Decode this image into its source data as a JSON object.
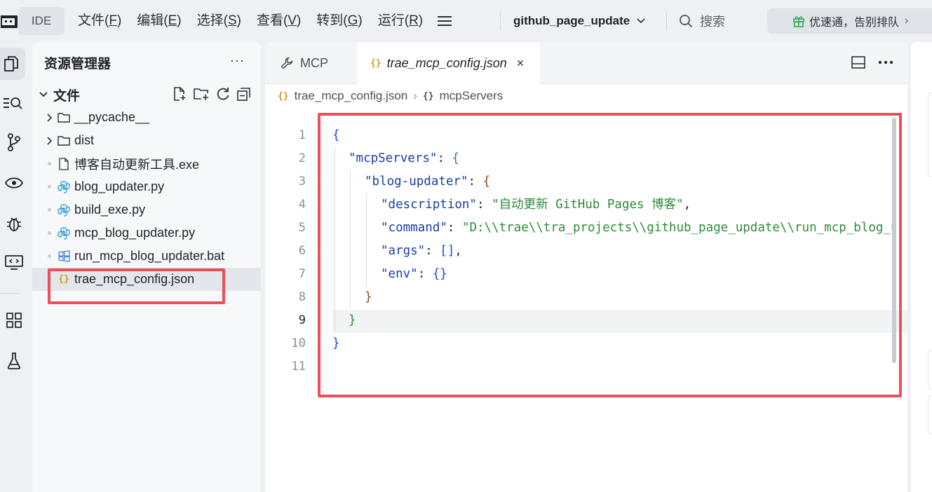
{
  "topbar": {
    "ide_label": "IDE",
    "menu": [
      {
        "text": "文件(",
        "key": "F",
        "end": ")"
      },
      {
        "text": "编辑(",
        "key": "E",
        "end": ")"
      },
      {
        "text": "选择(",
        "key": "S",
        "end": ")"
      },
      {
        "text": "查看(",
        "key": "V",
        "end": ")"
      },
      {
        "text": "转到(",
        "key": "G",
        "end": ")"
      },
      {
        "text": "运行(",
        "key": "R",
        "end": ")"
      }
    ],
    "project_name": "github_page_update",
    "search_label": "搜索",
    "promo_label": "优速通，告别排队",
    "promo_arrow": "›"
  },
  "explorer": {
    "title": "资源管理器",
    "more": "···",
    "folder_name": "文件",
    "items": [
      {
        "label": "__pycache__",
        "type": "folder"
      },
      {
        "label": "dist",
        "type": "folder"
      },
      {
        "label": "博客自动更新工具.exe",
        "type": "file"
      },
      {
        "label": "blog_updater.py",
        "type": "python"
      },
      {
        "label": "build_exe.py",
        "type": "python"
      },
      {
        "label": "mcp_blog_updater.py",
        "type": "python"
      },
      {
        "label": "run_mcp_blog_updater.bat",
        "type": "windows"
      },
      {
        "label": "trae_mcp_config.json",
        "type": "json"
      }
    ],
    "selected": "trae_mcp_config.json"
  },
  "editor": {
    "tabs": [
      {
        "label": "MCP",
        "icon": "wrench-icon"
      },
      {
        "label": "trae_mcp_config.json",
        "icon": "json-icon",
        "close": "×"
      }
    ],
    "breadcrumb": [
      "trae_mcp_config.json",
      "mcpServers"
    ],
    "json_icon_glyph": "{}",
    "breadcrumb_sep": "›",
    "line_numbers": [
      "1",
      "2",
      "3",
      "4",
      "5",
      "6",
      "7",
      "8",
      "9",
      "10",
      "11"
    ],
    "current_line": "9",
    "code": {
      "l1_open": "{",
      "l2_key": "\"mcpServers\"",
      "l2_colon": ": ",
      "l2_open": "{",
      "l3_key": "\"blog-updater\"",
      "l3_colon": ": ",
      "l3_open": "{",
      "l4_key": "\"description\"",
      "l4_colon": ": ",
      "l4_val": "\"自动更新 GitHub Pages 博客\"",
      "l4_comma": ",",
      "l5_key": "\"command\"",
      "l5_colon": ": ",
      "l5_val": "\"D:\\\\trae\\\\tra_projects\\\\github_page_update\\\\run_mcp_blog_updater.bat\"",
      "l6_key": "\"args\"",
      "l6_colon": ": ",
      "l6_val": "[]",
      "l6_comma": ",",
      "l7_key": "\"env\"",
      "l7_colon": ": ",
      "l7_val": "{}",
      "l8_close": "}",
      "l9_close": "}",
      "l10_close": "}"
    }
  },
  "colors": {
    "accent_red": "#e9505a",
    "json_icon": "#d19a1b",
    "python_icon": "#3a9fd8",
    "string": "#2e8b3a",
    "key": "#1a3fa8"
  }
}
